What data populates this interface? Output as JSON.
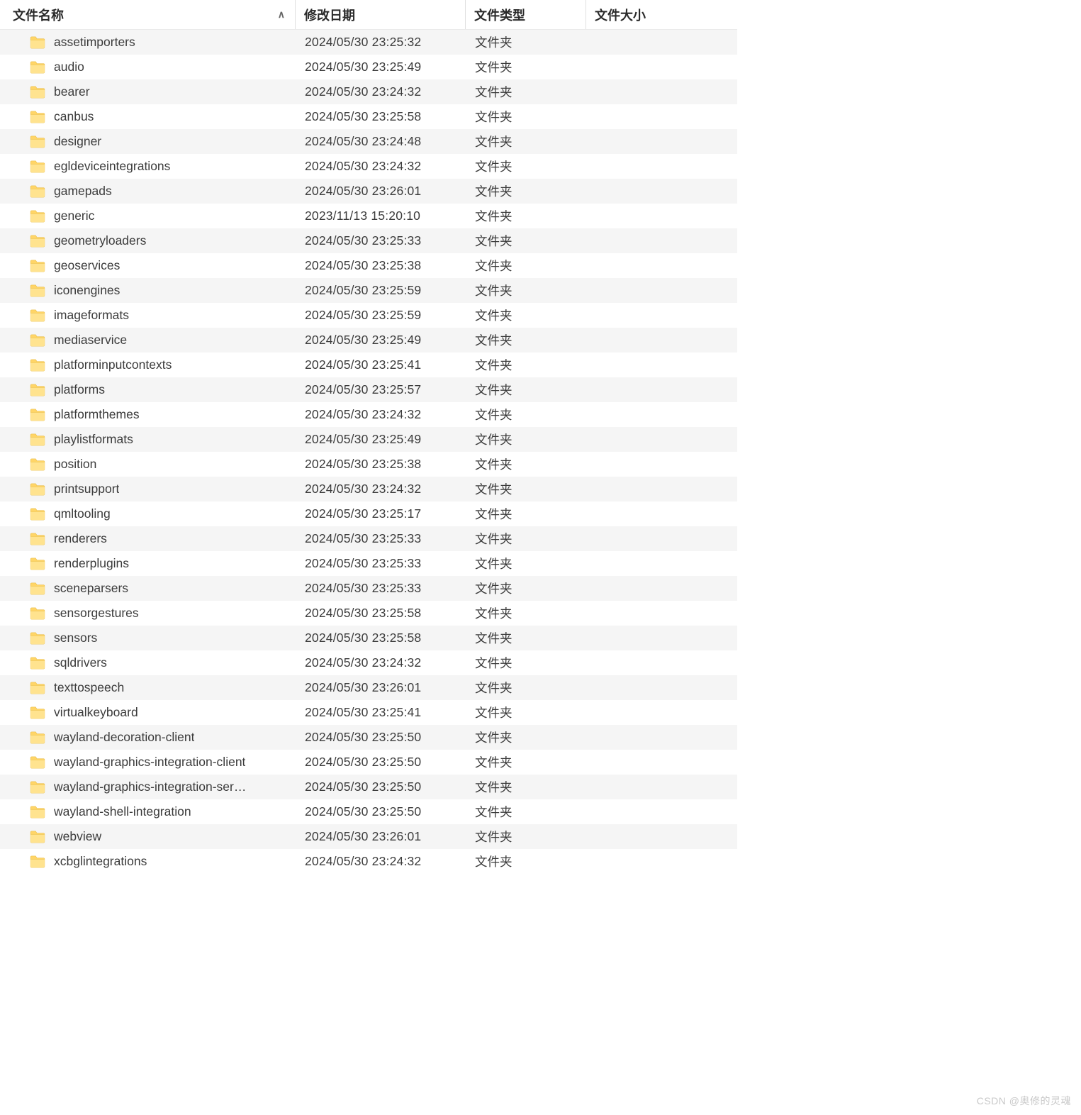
{
  "header": {
    "name": "文件名称",
    "date": "修改日期",
    "type": "文件类型",
    "size": "文件大小",
    "sort_glyph": "∧"
  },
  "default_type": "文件夹",
  "rows": [
    {
      "name": "assetimporters",
      "date": "2024/05/30 23:25:32"
    },
    {
      "name": "audio",
      "date": "2024/05/30 23:25:49"
    },
    {
      "name": "bearer",
      "date": "2024/05/30 23:24:32"
    },
    {
      "name": "canbus",
      "date": "2024/05/30 23:25:58"
    },
    {
      "name": "designer",
      "date": "2024/05/30 23:24:48"
    },
    {
      "name": "egldeviceintegrations",
      "date": "2024/05/30 23:24:32"
    },
    {
      "name": "gamepads",
      "date": "2024/05/30 23:26:01"
    },
    {
      "name": "generic",
      "date": "2023/11/13 15:20:10"
    },
    {
      "name": "geometryloaders",
      "date": "2024/05/30 23:25:33"
    },
    {
      "name": "geoservices",
      "date": "2024/05/30 23:25:38"
    },
    {
      "name": "iconengines",
      "date": "2024/05/30 23:25:59"
    },
    {
      "name": "imageformats",
      "date": "2024/05/30 23:25:59"
    },
    {
      "name": "mediaservice",
      "date": "2024/05/30 23:25:49"
    },
    {
      "name": "platforminputcontexts",
      "date": "2024/05/30 23:25:41"
    },
    {
      "name": "platforms",
      "date": "2024/05/30 23:25:57"
    },
    {
      "name": "platformthemes",
      "date": "2024/05/30 23:24:32"
    },
    {
      "name": "playlistformats",
      "date": "2024/05/30 23:25:49"
    },
    {
      "name": "position",
      "date": "2024/05/30 23:25:38"
    },
    {
      "name": "printsupport",
      "date": "2024/05/30 23:24:32"
    },
    {
      "name": "qmltooling",
      "date": "2024/05/30 23:25:17"
    },
    {
      "name": "renderers",
      "date": "2024/05/30 23:25:33"
    },
    {
      "name": "renderplugins",
      "date": "2024/05/30 23:25:33"
    },
    {
      "name": "sceneparsers",
      "date": "2024/05/30 23:25:33"
    },
    {
      "name": "sensorgestures",
      "date": "2024/05/30 23:25:58"
    },
    {
      "name": "sensors",
      "date": "2024/05/30 23:25:58"
    },
    {
      "name": "sqldrivers",
      "date": "2024/05/30 23:24:32"
    },
    {
      "name": "texttospeech",
      "date": "2024/05/30 23:26:01"
    },
    {
      "name": "virtualkeyboard",
      "date": "2024/05/30 23:25:41"
    },
    {
      "name": "wayland-decoration-client",
      "date": "2024/05/30 23:25:50"
    },
    {
      "name": "wayland-graphics-integration-client",
      "date": "2024/05/30 23:25:50"
    },
    {
      "name": "wayland-graphics-integration-ser…",
      "date": "2024/05/30 23:25:50"
    },
    {
      "name": "wayland-shell-integration",
      "date": "2024/05/30 23:25:50"
    },
    {
      "name": "webview",
      "date": "2024/05/30 23:26:01"
    },
    {
      "name": "xcbglintegrations",
      "date": "2024/05/30 23:24:32"
    }
  ],
  "watermark": "CSDN @奥修的灵魂"
}
